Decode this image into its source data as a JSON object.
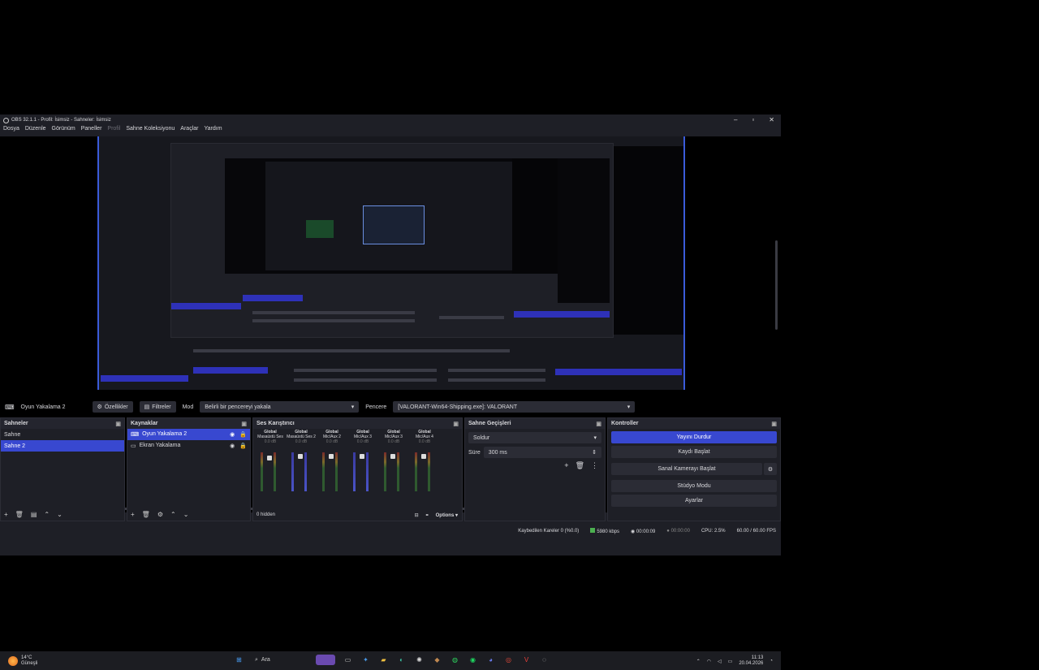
{
  "window": {
    "title": "OBS 32.1.1 - Profil: İsimsiz - Sahneler: İsimsiz",
    "controls": {
      "minimize": "–",
      "maximize": "▫",
      "close": "✕"
    }
  },
  "menu": [
    "Dosya",
    "Düzenle",
    "Görünüm",
    "Paneller",
    "Profil",
    "Sahne Koleksiyonu",
    "Araçlar",
    "Yardım"
  ],
  "source_bar": {
    "source_name": "Oyun Yakalama 2",
    "properties": "Özellikler",
    "filters": "Filtreler",
    "mode_label": "Mod",
    "mode_value": "Belirli bir pencereyi yakala",
    "window_label": "Pencere",
    "window_value": "[VALORANT-Win64-Shipping.exe]: VALORANT"
  },
  "scenes": {
    "title": "Sahneler",
    "items": [
      "Sahne",
      "Sahne 2"
    ],
    "selected": 1
  },
  "sources": {
    "title": "Kaynaklar",
    "items": [
      "Oyun Yakalama 2",
      "Ekran Yakalama"
    ]
  },
  "mixer": {
    "title": "Ses Karıştırıcı",
    "channels": [
      {
        "scope": "Global",
        "name": "Masaüstü Ses",
        "db": "0.0 dB"
      },
      {
        "scope": "Global",
        "name": "Masaüstü Ses 2",
        "db": "0.0 dB"
      },
      {
        "scope": "Global",
        "name": "Mic/Aux 2",
        "db": "0.0 dB"
      },
      {
        "scope": "Global",
        "name": "Mic/Aux 3",
        "db": "0.0 dB"
      },
      {
        "scope": "Global",
        "name": "Mic/Aux 3",
        "db": "0.0 dB"
      },
      {
        "scope": "Global",
        "name": "Mic/Aux 4",
        "db": "0.0 dB"
      }
    ],
    "hidden": "0 hidden",
    "options": "Options"
  },
  "transitions": {
    "title": "Sahne Geçişleri",
    "type": "Soldur",
    "duration_label": "Süre",
    "duration_value": "300 ms"
  },
  "controls": {
    "title": "Kontroller",
    "buttons": [
      "Yayını Durdur",
      "Kaydı Başlat",
      "Sanal Kamerayı Başlat",
      "Stüdyo Modu",
      "Ayarlar"
    ]
  },
  "status": {
    "dropped": "Kaybedilen Kareler 0 (%0.0)",
    "bitrate": "5980 kbps",
    "stream_time": "00:00:09",
    "rec_time": "00:00:00",
    "cpu": "CPU: 2.5%",
    "fps": "60.00 / 60.00 FPS"
  },
  "taskbar": {
    "temp": "14°C",
    "weather": "Güneşli",
    "search": "Ara",
    "time": "11:13",
    "date": "20.04.2026"
  },
  "colors": {
    "accent": "#3848d0",
    "bg": "#1e1f26"
  }
}
